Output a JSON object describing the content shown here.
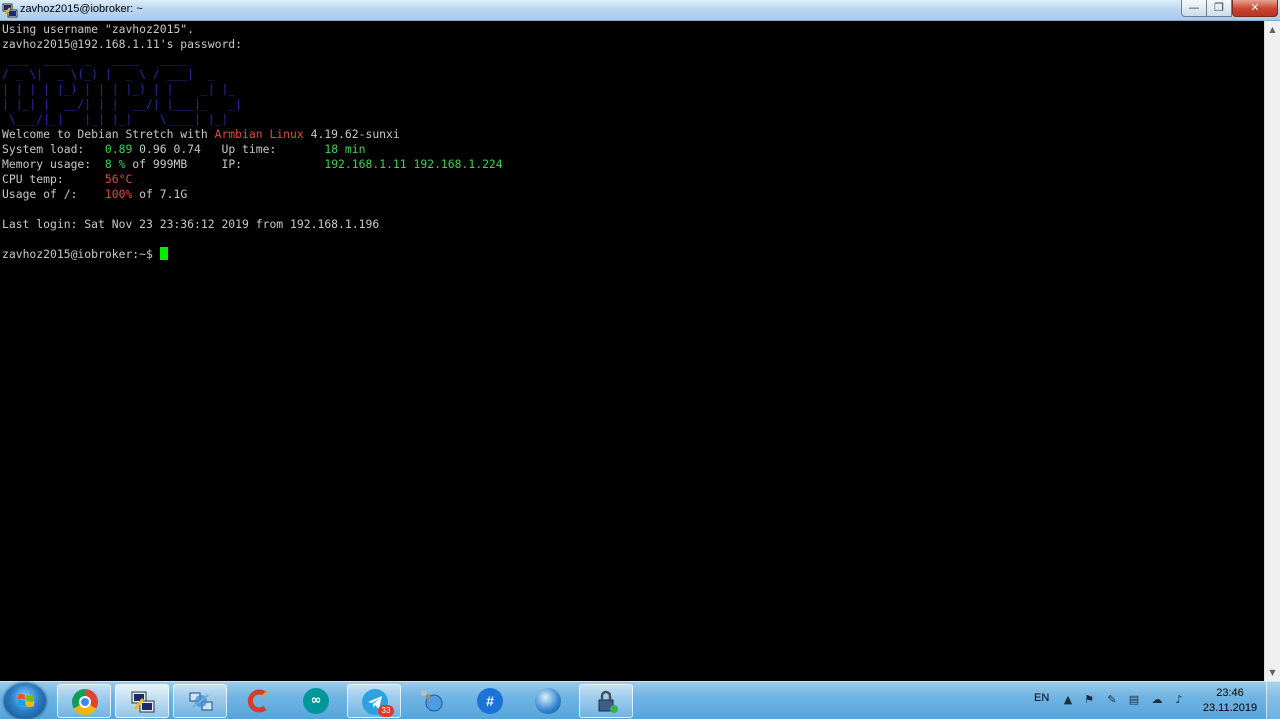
{
  "window": {
    "title": "zavhoz2015@iobroker: ~",
    "buttons": {
      "minimize": "—",
      "maximize": "❐",
      "close": "✕"
    }
  },
  "terminal": {
    "line_username": "Using username \"zavhoz2015\".",
    "line_password": "zavhoz2015@192.168.1.11's password:",
    "welcome_prefix": "Welcome to Debian Stretch with ",
    "welcome_armbian": "Armbian Linux",
    "welcome_kernel": " 4.19.62-sunxi",
    "system_load_label": "System load:   ",
    "system_load_1": "0.89",
    "system_load_rest": " 0.96 0.74   ",
    "uptime_label": "Up time:       ",
    "uptime_value": "18 min",
    "memory_label": "Memory usage:  ",
    "memory_pct": "8 %",
    "memory_rest": " of 999MB     ",
    "ip_label": "IP:            ",
    "ip_value": "192.168.1.11 192.168.1.224",
    "cpu_label": "CPU temp:      ",
    "cpu_value": "56°C",
    "usage_label": "Usage of /:    ",
    "usage_pct": "100%",
    "usage_rest": " of 7.1G",
    "last_login": "Last login: Sat Nov 23 23:36:12 2019 from 192.168.1.196",
    "prompt": "zavhoz2015@iobroker:~$ "
  },
  "taskbar": {
    "language": "EN",
    "telegram_badge": "33",
    "clock_time": "23:46",
    "clock_date": "23.11.2019"
  },
  "colors": {
    "green": "#39d353",
    "red": "#e24a3a",
    "cursor": "#00ee00"
  }
}
